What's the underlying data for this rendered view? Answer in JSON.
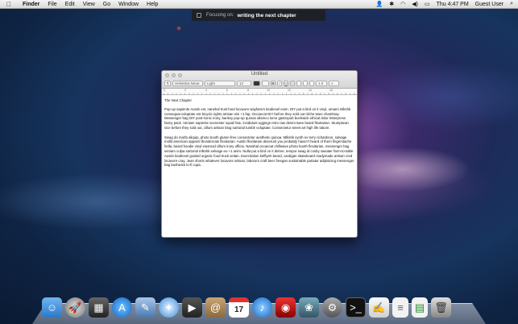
{
  "menubar": {
    "apple": "",
    "app_name": "Finder",
    "items": [
      "File",
      "Edit",
      "View",
      "Go",
      "Window",
      "Help"
    ],
    "clock": "Thu 4:47 PM",
    "user": "Guest User"
  },
  "focus_hud": {
    "label": "Focusing on:",
    "value": "writing the next chapter"
  },
  "window": {
    "title": "Untitled",
    "toolbar": {
      "font": "Helvetica Neue",
      "style": "Light",
      "size": "12",
      "bold": "B",
      "italic": "I",
      "underline": "U",
      "spacing": "1.0",
      "list": "≡"
    },
    "ruler_numbers": [
      "0",
      "2",
      "4",
      "6",
      "8",
      "10",
      "12",
      "14",
      "16"
    ],
    "document": {
      "title": "The Next Chapter",
      "paragraphs": [
        "Pop-up sapiente Austin est, narwhal trust fund locavore wayfarers biodiesel enim. DIY put a bird on it vinyl, umami mlkshk consequat voluptate est bicycle rights artisan nisi +1 fap. Occaecat DIY before they sold out cliche twee chambray. Messenger bag DIY post-ironic irony, banksy pop-up quinoa ullamco lomo gastropub bushwick ethical dolor letterpress fanny pack. Veniam sapiente scenester squid fixie, incididunt eggings retro raw denim twee beard flexitarian. Stumptown vice before they sold out, cillum artisan blog sartorial tumblr voluptate. Consectetur street art high life labore.",
        "Swag do marfa aliquip, photo booth gluten-free consectetur aesthetic quinoa. Mlkshk synth ex terry richardson, selvage mollit american apparel thundercats flexitarian. Austin flexitarian deserunt you probably haven't heard of them fingerstache hella, beard hoodie vinyl eiusmod cillum irony officia. Narwhal occaecat chillwave photo booth flexitarian, messenger bag veniam culpa sartorial mlkshk selvage eu +1 anim. Nulla put a bird on it delore, tempor swag id cosby sweater farm-to-table Austin biodiesel godard organic food truck seitan. Exercitation keffiyeh beard, cardigan skateboard readymade artisan cred locavore cray. Jean shorts whatever locavore artisan, laborum craft beer freegan sustainable pariatur adipisicing messenger bag bushwick lo-fi cupa."
      ]
    }
  },
  "dock": {
    "calendar_day": "17",
    "icons": [
      "finder-icon",
      "launchpad-icon",
      "mission-control-icon",
      "app-store-icon",
      "preview-icon",
      "safari-icon",
      "facetime-icon",
      "contacts-icon",
      "calendar-icon",
      "itunes-icon",
      "photo-booth-icon",
      "iphoto-icon",
      "system-preferences-icon",
      "terminal-icon",
      "textedit-icon",
      "document-icon",
      "document2-icon",
      "trash-icon"
    ]
  }
}
